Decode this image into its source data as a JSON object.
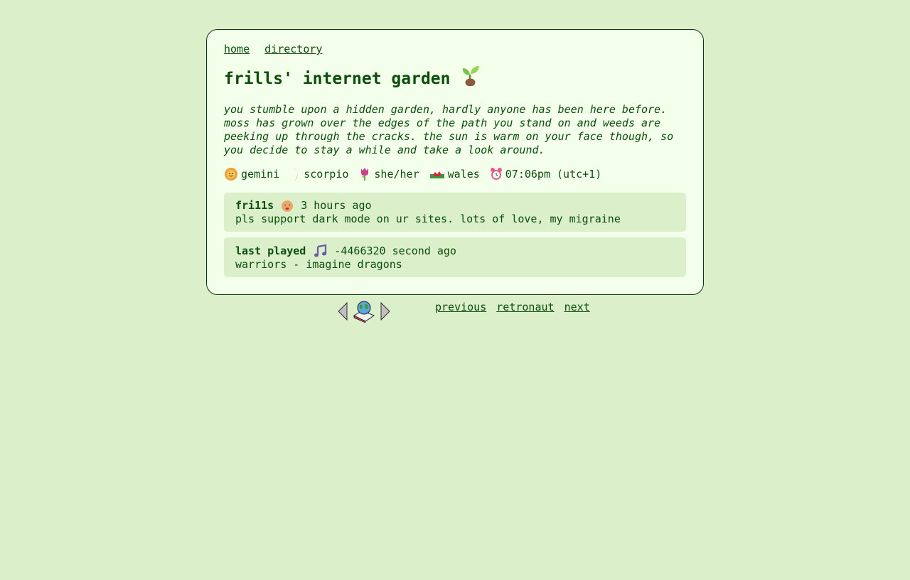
{
  "nav": {
    "home": "home",
    "directory": "directory"
  },
  "header": {
    "title": "frills' internet garden",
    "icon": "seedling-icon"
  },
  "description": "you stumble upon a hidden garden, hardly anyone has been here before. moss has grown over the edges of the path you stand on and weeds are peeking up through the cracks. the sun is warm on your face though, so you decide to stay a while and take a look around.",
  "facts": {
    "sign": "gemini",
    "moon": "scorpio",
    "pronouns": "she/her",
    "location": "wales",
    "time": "07:06pm (utc+1)"
  },
  "status": {
    "user": "fri11s",
    "time": "3 hours ago",
    "text": "pls support dark mode on ur sites. lots of love, my migraine"
  },
  "music": {
    "label": "last played",
    "time": "-4466320 second ago",
    "track": "warriors - imagine dragons"
  },
  "webring": {
    "previous": "previous",
    "name": "retronaut",
    "next": "next"
  }
}
